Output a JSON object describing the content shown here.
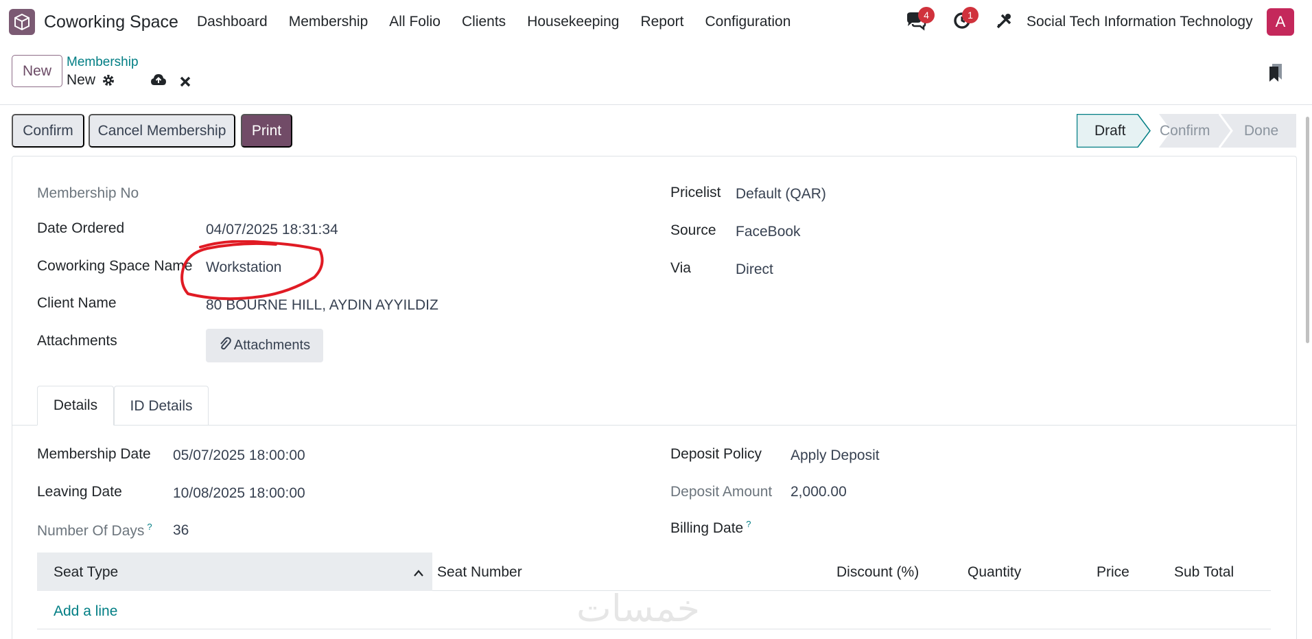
{
  "navbar": {
    "app_name": "Coworking Space",
    "menu": [
      "Dashboard",
      "Membership",
      "All Folio",
      "Clients",
      "Housekeeping",
      "Report",
      "Configuration"
    ],
    "chat_badge": "4",
    "activity_badge": "1",
    "company": "Social Tech Information Technology",
    "avatar_letter": "A",
    "brand_color": "#714b67",
    "avatar_color": "#c4285b"
  },
  "control_panel": {
    "new_label": "New",
    "breadcrumb_parent": "Membership",
    "breadcrumb_current": "New"
  },
  "statusbar": {
    "buttons": {
      "confirm": "Confirm",
      "cancel": "Cancel Membership",
      "print": "Print"
    },
    "stages": [
      "Draft",
      "Confirm",
      "Done"
    ],
    "active_stage": "Draft"
  },
  "form": {
    "membership_no_label": "Membership No",
    "date_ordered_label": "Date Ordered",
    "date_ordered": "04/07/2025 18:31:34",
    "space_name_label": "Coworking Space Name",
    "space_name": "Workstation",
    "client_name_label": "Client Name",
    "client_name": "80 BOURNE HILL, AYDIN AYYILDIZ",
    "attachments_label": "Attachments",
    "attachments_button": "Attachments",
    "pricelist_label": "Pricelist",
    "pricelist": "Default (QAR)",
    "source_label": "Source",
    "source": "FaceBook",
    "via_label": "Via",
    "via": "Direct"
  },
  "tabs": [
    "Details",
    "ID Details"
  ],
  "details": {
    "membership_date_label": "Membership Date",
    "membership_date": "05/07/2025 18:00:00",
    "leaving_date_label": "Leaving Date",
    "leaving_date": "10/08/2025 18:00:00",
    "days_label": "Number Of Days",
    "days": "36",
    "deposit_policy_label": "Deposit Policy",
    "deposit_policy": "Apply Deposit",
    "deposit_amount_label": "Deposit Amount",
    "deposit_amount": "2,000.00",
    "billing_date_label": "Billing Date",
    "help_mark": "?"
  },
  "table": {
    "columns": [
      "Seat Type",
      "Seat Number",
      "Discount (%)",
      "Quantity",
      "Price",
      "Sub Total"
    ],
    "add_line": "Add a line"
  },
  "watermark": "خمسات",
  "annotation_color": "#e01b24"
}
